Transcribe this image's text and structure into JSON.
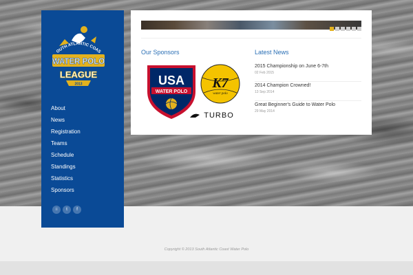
{
  "logo": {
    "line1": "SOUTH ATLANTIC COAST",
    "line2": "WATER POLO",
    "line3": "LEAGUE",
    "year": "2013"
  },
  "nav": {
    "items": [
      {
        "label": "About"
      },
      {
        "label": "News"
      },
      {
        "label": "Registration"
      },
      {
        "label": "Teams"
      },
      {
        "label": "Schedule"
      },
      {
        "label": "Standings"
      },
      {
        "label": "Statistics"
      },
      {
        "label": "Sponsors"
      }
    ]
  },
  "social": {
    "icons": [
      {
        "icon": "rss-icon",
        "glyph": "≡"
      },
      {
        "icon": "twitter-icon",
        "glyph": "t"
      },
      {
        "icon": "facebook-icon",
        "glyph": "f"
      }
    ]
  },
  "slider": {
    "active_index": 0,
    "count": 6
  },
  "sponsors": {
    "title": "Our Sponsors",
    "usa_top": "USA",
    "usa_bottom": "WATER POLO",
    "kap7_text": "K7",
    "kap7_sub": "water polo",
    "turbo": "TURBO"
  },
  "news": {
    "title": "Latest News",
    "items": [
      {
        "title": "2015 Championship on June 6-7th",
        "date": "02 Feb 2015"
      },
      {
        "title": "2014 Champion Crowned!",
        "date": "13 Sep 2014"
      },
      {
        "title": "Great Beginner's Guide to Water Polo",
        "date": "29 May 2014"
      }
    ]
  },
  "footer": {
    "copyright": "Copyright © 2013 South Atlantic Coast Water Polo"
  },
  "colors": {
    "sidebar": "#0a4a96",
    "accent": "#2a6fb5",
    "dot_active": "#e3b21e"
  }
}
